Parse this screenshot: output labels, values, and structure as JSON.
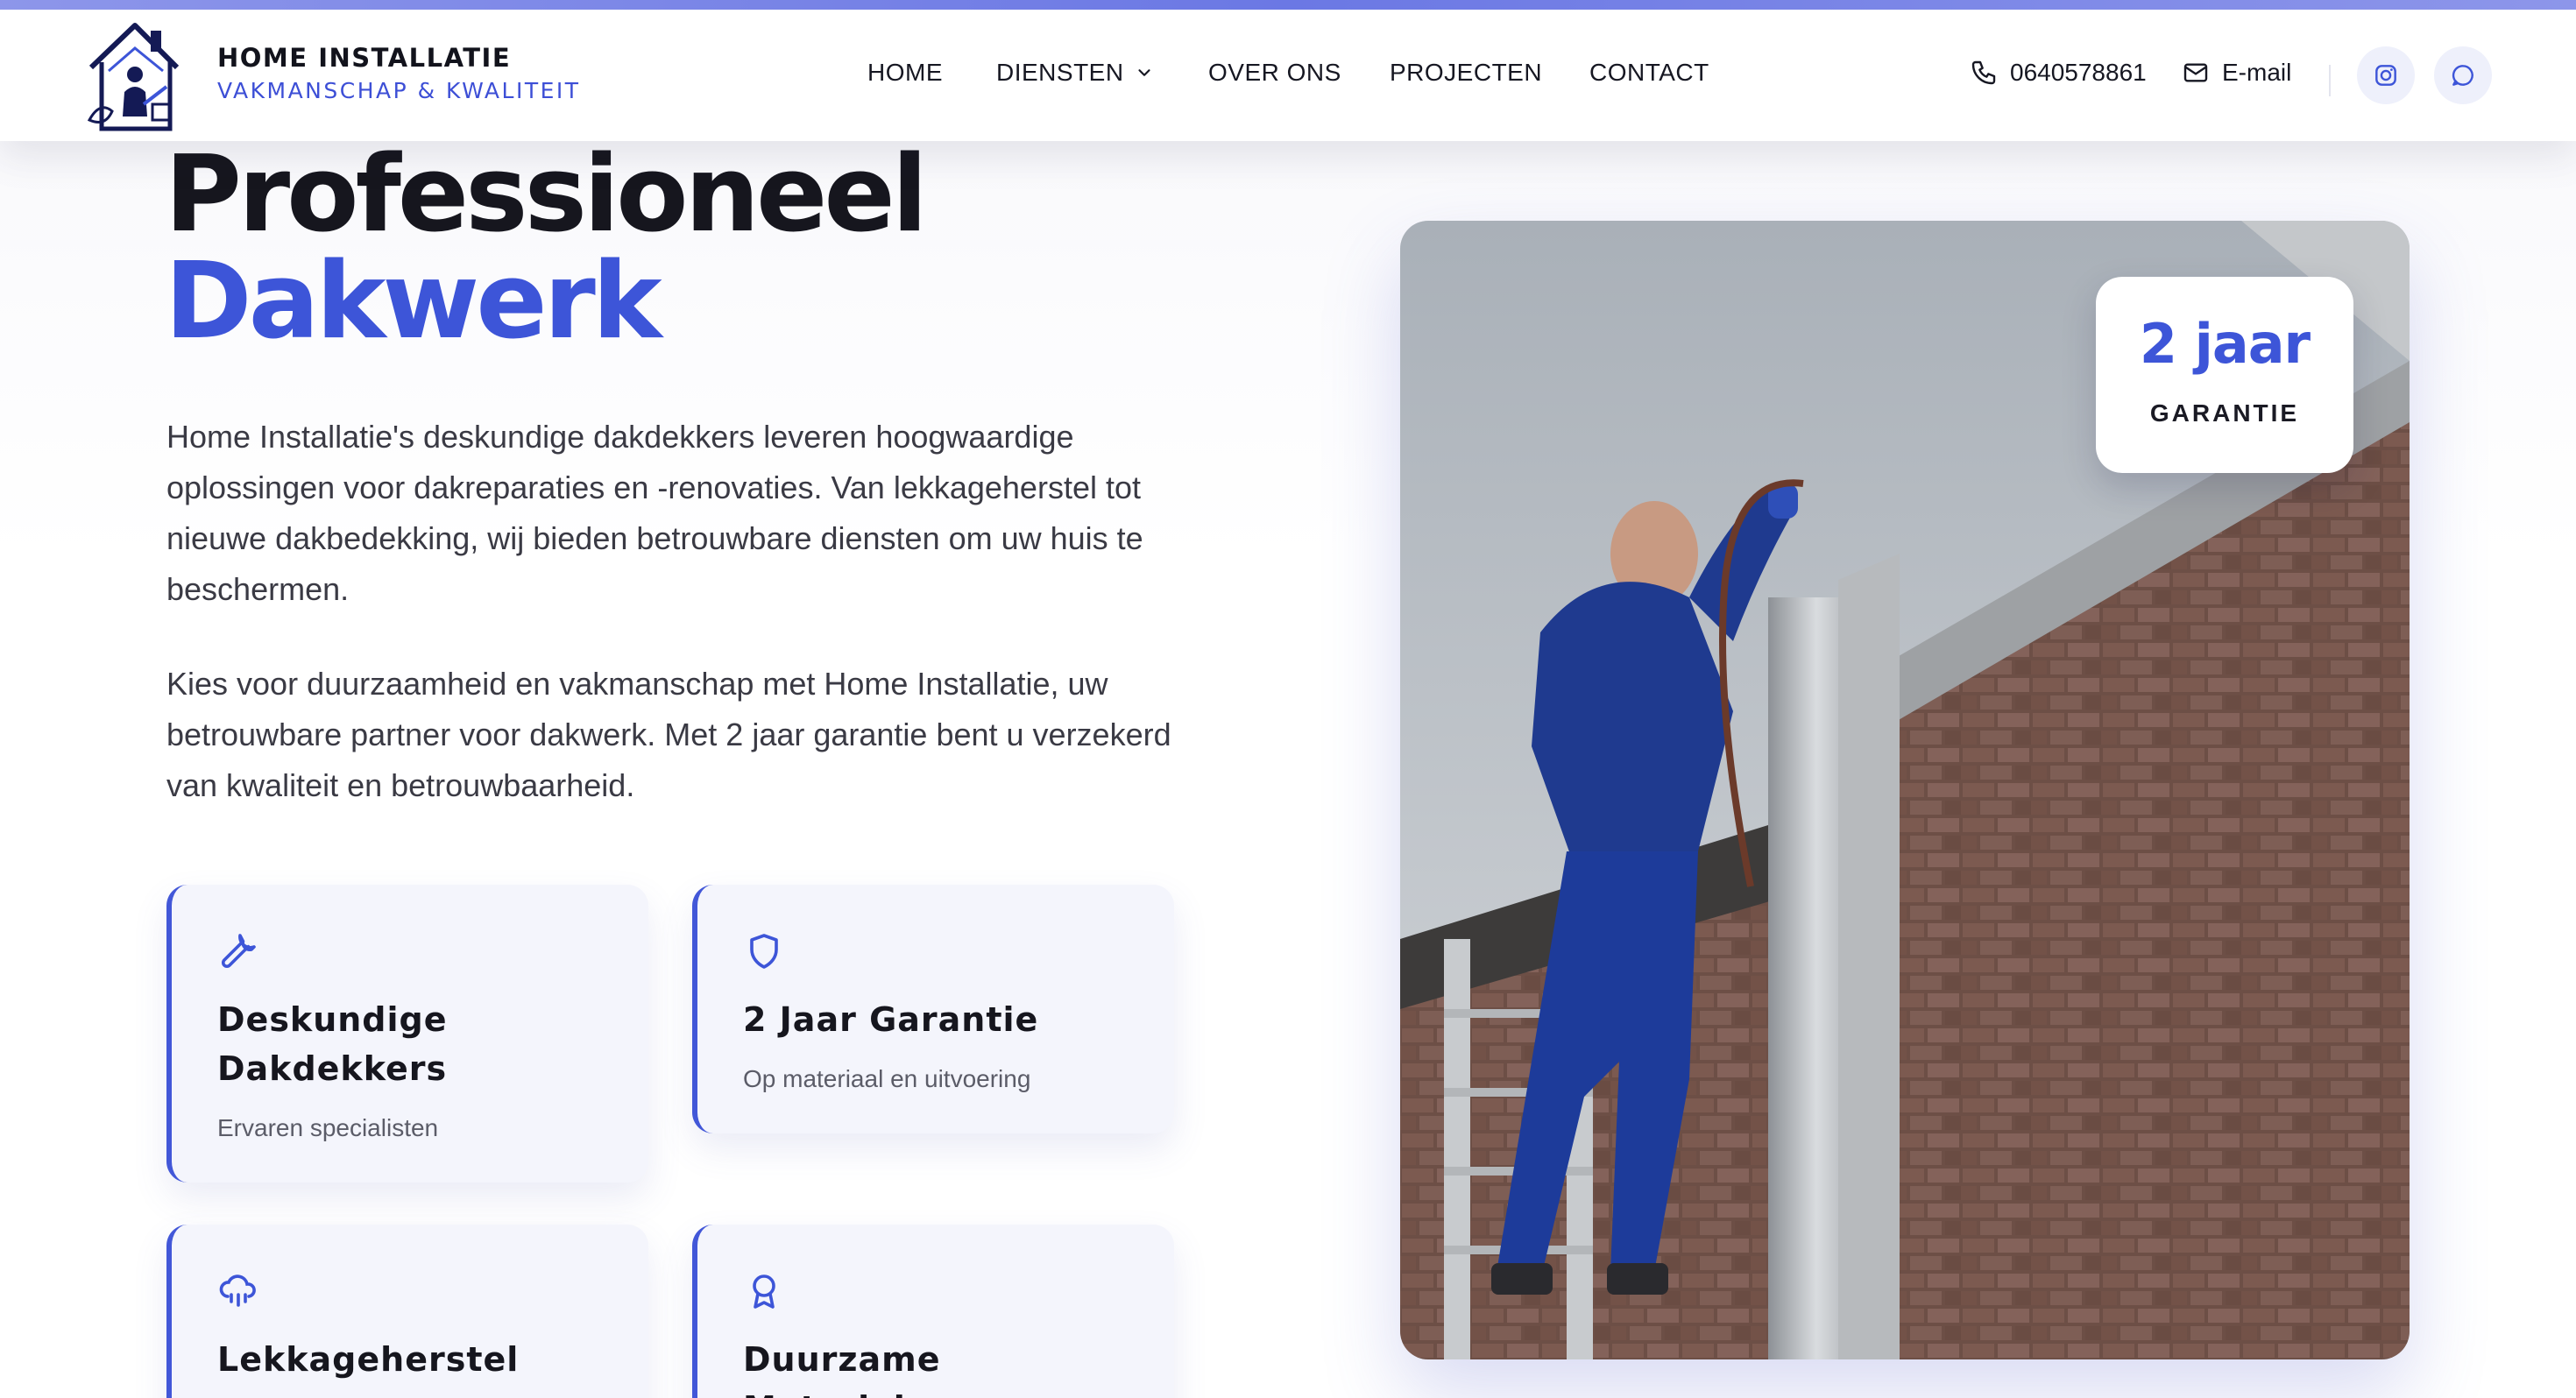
{
  "brand": {
    "name": "HOME INSTALLATIE",
    "tagline": "VAKMANSCHAP & KWALITEIT"
  },
  "nav": {
    "items": [
      {
        "label": "HOME"
      },
      {
        "label": "DIENSTEN",
        "icon": "chevron-down-icon"
      },
      {
        "label": "OVER ONS"
      },
      {
        "label": "PROJECTEN"
      },
      {
        "label": "CONTACT"
      }
    ]
  },
  "contact": {
    "phone": "0640578861",
    "email_label": "E-mail"
  },
  "social": {
    "icons": [
      "instagram-icon",
      "message-icon"
    ]
  },
  "hero": {
    "title_line1": "Professioneel",
    "title_line2": "Dakwerk",
    "paragraph1": "Home Installatie's deskundige dakdekkers leveren hoogwaardige oplossingen voor dakreparaties en -renovaties. Van lekkageherstel tot nieuwe dakbedekking, wij bieden betrouwbare diensten om uw huis te beschermen.",
    "paragraph2": "Kies voor duurzaamheid en vakmanschap met Home Installatie, uw betrouwbare partner voor dakwerk. Met 2 jaar garantie bent u verzekerd van kwaliteit en betrouwbaarheid."
  },
  "features": [
    {
      "icon": "wrench-icon",
      "title": "Deskundige Dakdekkers",
      "desc": "Ervaren specialisten"
    },
    {
      "icon": "shield-icon",
      "title": "2 Jaar Garantie",
      "desc": "Op materiaal en uitvoering"
    },
    {
      "icon": "cloud-rain-icon",
      "title": "Lekkageherstel",
      "desc": ""
    },
    {
      "icon": "award-icon",
      "title": "Duurzame Materialen",
      "desc": ""
    }
  ],
  "badge": {
    "value": "2 jaar",
    "label": "GARANTIE"
  },
  "colors": {
    "accent": "#3d55d8",
    "card_bg": "#f4f5fc",
    "text": "#16161e"
  }
}
